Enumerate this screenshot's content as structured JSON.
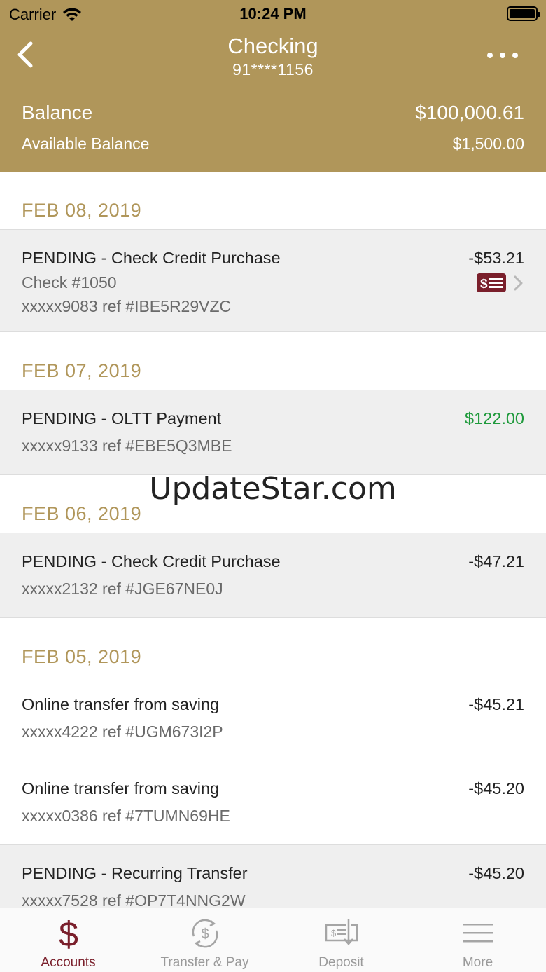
{
  "status_bar": {
    "carrier": "Carrier",
    "time": "10:24 PM"
  },
  "nav": {
    "title": "Checking",
    "account_mask": "91****1156"
  },
  "balance": {
    "label": "Balance",
    "value": "$100,000.61",
    "available_label": "Available Balance",
    "available_value": "$1,500.00"
  },
  "groups": [
    {
      "date": "FEB 08, 2019",
      "transactions": [
        {
          "description": "PENDING - Check Credit Purchase",
          "check": "Check #1050",
          "reference": "xxxxx9083 ref #IBE5R29VZC",
          "amount": "-$53.21"
        }
      ]
    },
    {
      "date": "FEB 07, 2019",
      "transactions": [
        {
          "description": "PENDING - OLTT Payment",
          "reference": "xxxxx9133 ref #EBE5Q3MBE",
          "amount": "$122.00"
        }
      ]
    },
    {
      "date": "FEB 06, 2019",
      "transactions": [
        {
          "description": "PENDING - Check Credit Purchase",
          "reference": "xxxxx2132 ref #JGE67NE0J",
          "amount": "-$47.21"
        }
      ]
    },
    {
      "date": "FEB 05, 2019",
      "transactions": [
        {
          "description": "Online transfer from saving",
          "reference": "xxxxx4222 ref #UGM673I2P",
          "amount": "-$45.21"
        },
        {
          "description": "Online transfer from saving",
          "reference": "xxxxx0386 ref #7TUMN69HE",
          "amount": "-$45.20"
        },
        {
          "description": "PENDING - Recurring Transfer",
          "reference": "xxxxx7528 ref #OP7T4NNG2W",
          "amount": "-$45.20"
        }
      ]
    }
  ],
  "watermark": "UpdateStar.com",
  "tabs": [
    {
      "label": "Accounts",
      "icon": "dollar-icon"
    },
    {
      "label": "Transfer & Pay",
      "icon": "transfer-icon"
    },
    {
      "label": "Deposit",
      "icon": "deposit-check-icon"
    },
    {
      "label": "More",
      "icon": "menu-icon"
    }
  ],
  "colors": {
    "brand_gold": "#b0965a",
    "accent_maroon": "#7a1f2b",
    "credit_green": "#1f9a3c"
  }
}
